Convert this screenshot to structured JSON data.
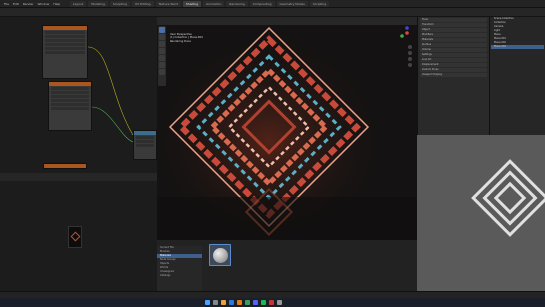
{
  "app": {
    "menu": [
      "File",
      "Edit",
      "Render",
      "Window",
      "Help"
    ],
    "workspace_tabs": [
      "Layout",
      "Modeling",
      "Sculpting",
      "UV Editing",
      "Texture Paint",
      "Shading",
      "Animation",
      "Rendering",
      "Compositing",
      "Geometry Nodes",
      "Scripting"
    ],
    "active_tab": "Shading"
  },
  "viewport": {
    "info_lines": [
      "User Perspective",
      "(1) Collection | Plane.004",
      "Rendering Done"
    ],
    "toolbar_count": 7
  },
  "properties": {
    "rows": [
      "Tools",
      "Transform",
      "Object",
      "Modifiers",
      "Materials",
      "Surface",
      "Volume",
      "Settings",
      "Line Art",
      "Displacement",
      "Custom Props",
      "Viewport Display"
    ]
  },
  "outliner": {
    "rows": [
      "Scene Collection",
      "Collection",
      "Camera",
      "Light",
      "Plane",
      "Plane.001",
      "Plane.002",
      "Plane.004"
    ],
    "selected_index": 7
  },
  "asset_browser": {
    "side_items": [
      "Current File",
      "Brushes",
      "Materials",
      "Node Groups",
      "Objects",
      "Worlds",
      "Unassigned",
      "Catalogs"
    ],
    "selected_index": 2
  },
  "colors": {
    "node_header_orange": "#a9571f",
    "node_header_blue": "#3b6d8c",
    "selection": "#3f5f8f",
    "logo_gray": "#e0e0e0"
  }
}
